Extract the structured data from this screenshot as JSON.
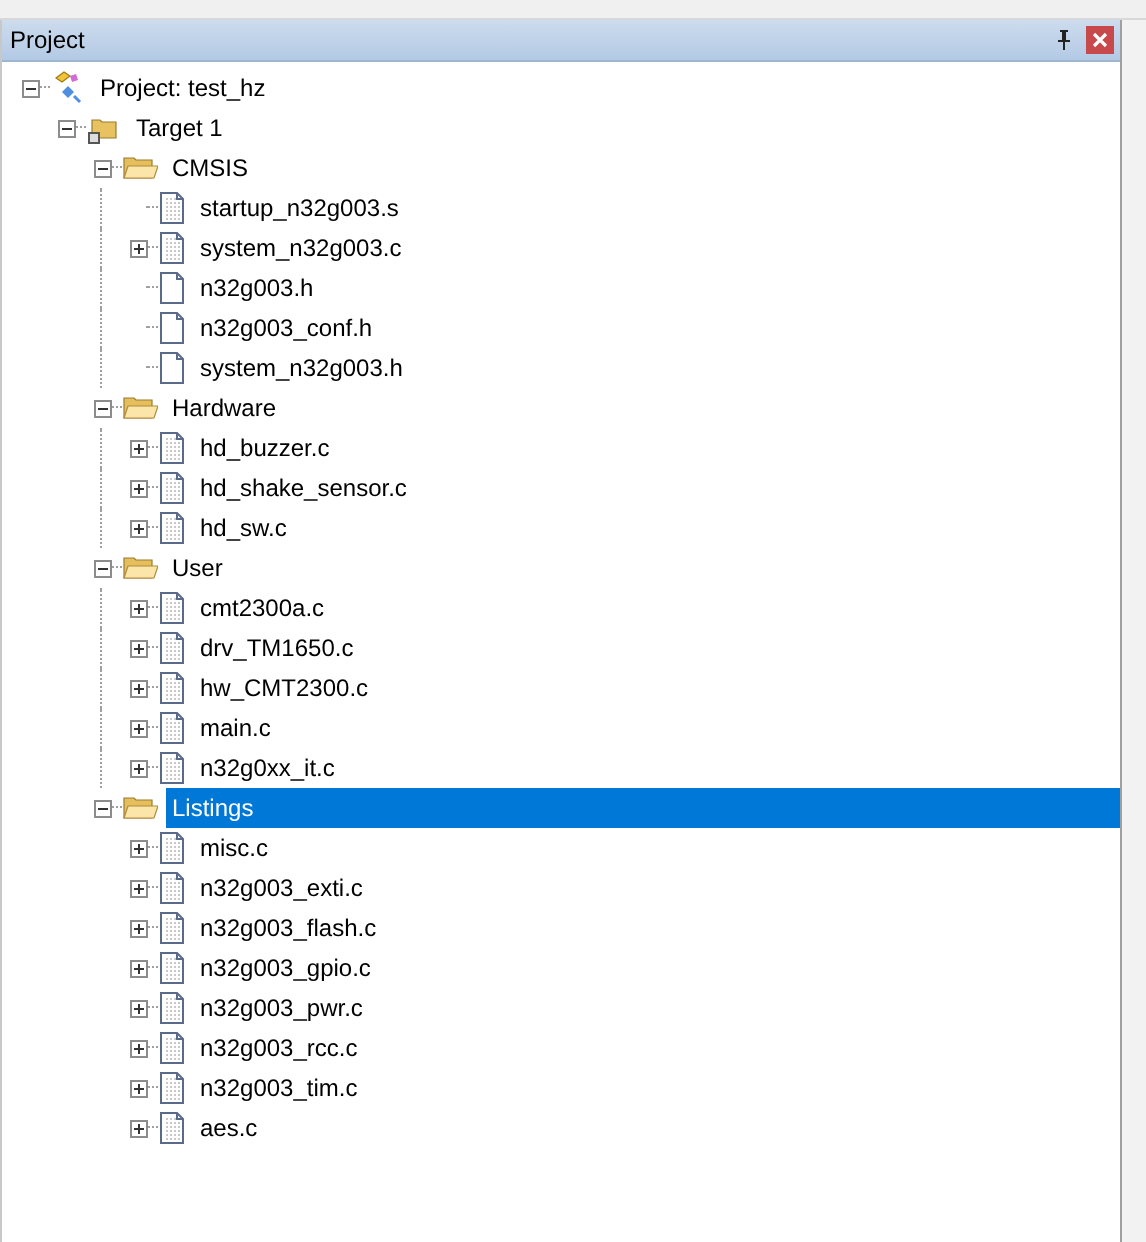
{
  "panel": {
    "title": "Project"
  },
  "tree": [
    {
      "label": "Project: test_hz",
      "kind": "project",
      "expanded": true,
      "selected": false,
      "children": [
        {
          "label": "Target 1",
          "kind": "target",
          "expanded": true,
          "selected": false,
          "children": [
            {
              "label": "CMSIS",
              "kind": "group",
              "expanded": true,
              "selected": false,
              "children": [
                {
                  "label": "startup_n32g003.s",
                  "kind": "file",
                  "expandable": false,
                  "selected": false
                },
                {
                  "label": "system_n32g003.c",
                  "kind": "file",
                  "expandable": true,
                  "selected": false
                },
                {
                  "label": "n32g003.h",
                  "kind": "header",
                  "expandable": false,
                  "selected": false
                },
                {
                  "label": "n32g003_conf.h",
                  "kind": "header",
                  "expandable": false,
                  "selected": false
                },
                {
                  "label": "system_n32g003.h",
                  "kind": "header",
                  "expandable": false,
                  "selected": false
                }
              ]
            },
            {
              "label": "Hardware",
              "kind": "group",
              "expanded": true,
              "selected": false,
              "children": [
                {
                  "label": "hd_buzzer.c",
                  "kind": "file",
                  "expandable": true,
                  "selected": false
                },
                {
                  "label": "hd_shake_sensor.c",
                  "kind": "file",
                  "expandable": true,
                  "selected": false
                },
                {
                  "label": "hd_sw.c",
                  "kind": "file",
                  "expandable": true,
                  "selected": false
                }
              ]
            },
            {
              "label": "User",
              "kind": "group",
              "expanded": true,
              "selected": false,
              "children": [
                {
                  "label": "cmt2300a.c",
                  "kind": "file",
                  "expandable": true,
                  "selected": false
                },
                {
                  "label": "drv_TM1650.c",
                  "kind": "file",
                  "expandable": true,
                  "selected": false
                },
                {
                  "label": "hw_CMT2300.c",
                  "kind": "file",
                  "expandable": true,
                  "selected": false
                },
                {
                  "label": "main.c",
                  "kind": "file",
                  "expandable": true,
                  "selected": false
                },
                {
                  "label": "n32g0xx_it.c",
                  "kind": "file",
                  "expandable": true,
                  "selected": false
                }
              ]
            },
            {
              "label": "Listings",
              "kind": "group",
              "expanded": true,
              "selected": true,
              "children": [
                {
                  "label": "misc.c",
                  "kind": "file",
                  "expandable": true,
                  "selected": false
                },
                {
                  "label": "n32g003_exti.c",
                  "kind": "file",
                  "expandable": true,
                  "selected": false
                },
                {
                  "label": "n32g003_flash.c",
                  "kind": "file",
                  "expandable": true,
                  "selected": false
                },
                {
                  "label": "n32g003_gpio.c",
                  "kind": "file",
                  "expandable": true,
                  "selected": false
                },
                {
                  "label": "n32g003_pwr.c",
                  "kind": "file",
                  "expandable": true,
                  "selected": false
                },
                {
                  "label": "n32g003_rcc.c",
                  "kind": "file",
                  "expandable": true,
                  "selected": false
                },
                {
                  "label": "n32g003_tim.c",
                  "kind": "file",
                  "expandable": true,
                  "selected": false
                },
                {
                  "label": "aes.c",
                  "kind": "file",
                  "expandable": true,
                  "selected": false
                }
              ]
            }
          ]
        }
      ]
    }
  ]
}
